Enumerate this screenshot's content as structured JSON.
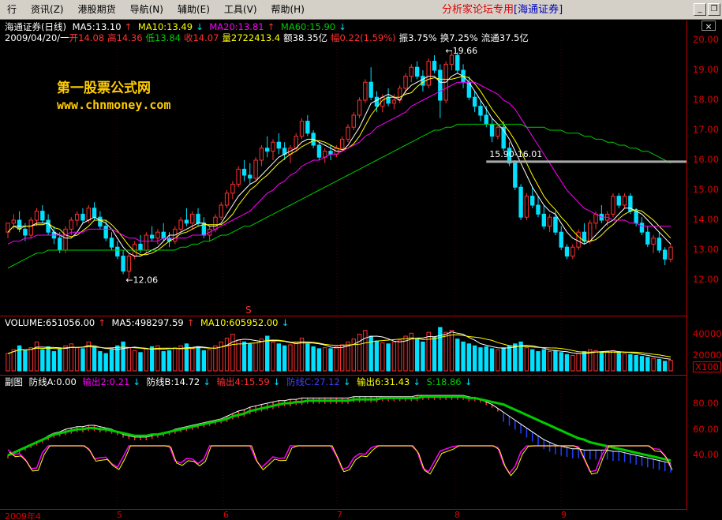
{
  "menu": {
    "items": [
      "行",
      "资讯(Z)",
      "港股期货",
      "导航(N)",
      "辅助(E)",
      "工具(V)",
      "帮助(H)"
    ],
    "title": "分析家论坛专用",
    "broker": "[海通证券]",
    "close": "×"
  },
  "main": {
    "stock": "海通证券(日线)",
    "ma5": "MA5:13.10",
    "ma10": "MA10:13.49",
    "ma20": "MA20:13.81",
    "ma60": "MA60:15.90",
    "info": {
      "date": "2009/04/20/一",
      "open": "开14.08",
      "high": "高14.36",
      "low": "低13.84",
      "close": "收14.07",
      "vol": "量2722413.4",
      "amount": "额38.35亿",
      "change": "幅0.22(1.59%)",
      "amplitude": "振3.75%",
      "turnover": "换7.25%",
      "float": "流通37.5亿"
    },
    "hi_label": "19.66",
    "lo_label": "12.06",
    "range_label": "15.90-16.01",
    "s_marker": "S",
    "watermark1": "第一股票公式网",
    "watermark2": "www.chnmoney.com",
    "y_labels": [
      "20.00",
      "19.00",
      "18.00",
      "17.00",
      "16.00",
      "15.00",
      "14.00",
      "13.00",
      "12.00"
    ]
  },
  "volume": {
    "label": "VOLUME:651056.00",
    "ma5": "MA5:498297.59",
    "ma10": "MA10:605952.00",
    "y_labels": [
      "40000",
      "20000",
      "X100"
    ]
  },
  "sub": {
    "title": "副图",
    "a": "防线A:0.00",
    "o2": "输出2:0.21",
    "b": "防线B:14.72",
    "o4": "输出4:15.59",
    "c": "防线C:27.12",
    "o6": "输出6:31.43",
    "s": "S:18.86",
    "y_labels": [
      "80.00",
      "60.00",
      "40.00"
    ]
  },
  "xaxis": [
    "2009年4",
    "5",
    "6",
    "7",
    "8",
    "9"
  ],
  "colors": {
    "up": "#ff3030",
    "down": "#00e0ff",
    "ma5": "#ffffff",
    "ma10": "#ffff00",
    "ma20": "#ff00ff",
    "ma60": "#00cc00",
    "grid": "#c00000"
  },
  "chart_data": {
    "type": "candlestick",
    "title": "海通证券(日线)",
    "price_axis": [
      12,
      20
    ],
    "candles": [
      [
        13.6,
        13.9,
        13.4,
        13.9
      ],
      [
        13.9,
        14.2,
        13.7,
        14.0
      ],
      [
        14.0,
        14.3,
        13.6,
        13.7
      ],
      [
        13.7,
        13.9,
        13.3,
        13.5
      ],
      [
        13.5,
        14.1,
        13.4,
        14.0
      ],
      [
        14.0,
        14.4,
        13.8,
        14.3
      ],
      [
        14.3,
        14.5,
        13.9,
        14.0
      ],
      [
        14.0,
        14.2,
        13.5,
        13.6
      ],
      [
        13.6,
        13.8,
        13.2,
        13.4
      ],
      [
        13.4,
        13.6,
        12.9,
        13.0
      ],
      [
        13.0,
        13.8,
        12.9,
        13.7
      ],
      [
        13.7,
        14.1,
        13.5,
        14.0
      ],
      [
        14.0,
        14.3,
        13.8,
        14.2
      ],
      [
        14.2,
        14.4,
        13.9,
        14.0
      ],
      [
        14.0,
        14.5,
        13.9,
        14.4
      ],
      [
        14.4,
        14.6,
        14.0,
        14.1
      ],
      [
        14.1,
        14.3,
        13.7,
        13.8
      ],
      [
        13.8,
        14.0,
        13.3,
        13.4
      ],
      [
        13.4,
        13.6,
        13.0,
        13.1
      ],
      [
        13.1,
        13.3,
        12.7,
        12.8
      ],
      [
        12.8,
        13.0,
        12.2,
        12.3
      ],
      [
        12.3,
        12.9,
        12.06,
        12.8
      ],
      [
        12.8,
        13.3,
        12.7,
        13.2
      ],
      [
        13.2,
        13.5,
        12.9,
        13.0
      ],
      [
        13.0,
        13.6,
        12.9,
        13.5
      ],
      [
        13.5,
        13.8,
        13.3,
        13.4
      ],
      [
        13.4,
        13.7,
        13.2,
        13.6
      ],
      [
        13.6,
        13.9,
        13.3,
        13.4
      ],
      [
        13.4,
        13.6,
        13.1,
        13.3
      ],
      [
        13.3,
        13.8,
        13.2,
        13.7
      ],
      [
        13.7,
        14.1,
        13.6,
        14.0
      ],
      [
        14.0,
        14.4,
        13.8,
        13.9
      ],
      [
        13.9,
        14.3,
        13.7,
        14.2
      ],
      [
        14.2,
        14.4,
        13.8,
        13.9
      ],
      [
        13.9,
        14.1,
        13.4,
        13.5
      ],
      [
        13.5,
        13.8,
        13.3,
        13.7
      ],
      [
        13.7,
        14.2,
        13.6,
        14.1
      ],
      [
        14.1,
        14.6,
        14.0,
        14.5
      ],
      [
        14.5,
        15.0,
        14.4,
        14.9
      ],
      [
        14.9,
        15.3,
        14.7,
        15.2
      ],
      [
        15.2,
        15.8,
        15.1,
        15.7
      ],
      [
        15.7,
        16.0,
        15.3,
        15.5
      ],
      [
        15.5,
        15.9,
        15.2,
        15.4
      ],
      [
        15.4,
        16.1,
        15.3,
        16.0
      ],
      [
        16.0,
        16.5,
        15.8,
        16.4
      ],
      [
        16.4,
        16.8,
        16.1,
        16.3
      ],
      [
        16.3,
        16.7,
        16.0,
        16.6
      ],
      [
        16.6,
        16.9,
        16.2,
        16.4
      ],
      [
        16.4,
        16.6,
        16.0,
        16.2
      ],
      [
        16.2,
        16.5,
        15.9,
        16.4
      ],
      [
        16.4,
        16.9,
        16.3,
        16.8
      ],
      [
        16.8,
        17.4,
        16.7,
        17.3
      ],
      [
        17.3,
        17.5,
        16.8,
        16.9
      ],
      [
        16.9,
        17.0,
        16.4,
        16.5
      ],
      [
        16.5,
        16.6,
        16.0,
        16.1
      ],
      [
        16.1,
        16.4,
        15.9,
        16.3
      ],
      [
        16.3,
        16.5,
        16.0,
        16.2
      ],
      [
        16.2,
        16.5,
        16.1,
        16.4
      ],
      [
        16.4,
        16.8,
        16.3,
        16.7
      ],
      [
        16.7,
        17.2,
        16.6,
        17.1
      ],
      [
        17.1,
        17.6,
        17.0,
        17.5
      ],
      [
        17.5,
        18.1,
        17.4,
        18.0
      ],
      [
        18.0,
        18.7,
        17.9,
        18.6
      ],
      [
        18.6,
        19.1,
        18.0,
        18.1
      ],
      [
        18.1,
        18.3,
        17.6,
        17.8
      ],
      [
        17.8,
        18.2,
        17.6,
        18.1
      ],
      [
        18.1,
        18.4,
        17.8,
        17.9
      ],
      [
        17.9,
        18.2,
        17.7,
        18.0
      ],
      [
        18.0,
        18.5,
        17.9,
        18.4
      ],
      [
        18.4,
        18.9,
        18.2,
        18.8
      ],
      [
        18.8,
        19.2,
        18.6,
        19.1
      ],
      [
        19.1,
        19.3,
        18.7,
        18.8
      ],
      [
        18.8,
        19.0,
        18.3,
        18.5
      ],
      [
        18.5,
        19.4,
        18.4,
        19.3
      ],
      [
        19.3,
        19.5,
        18.9,
        19.0
      ],
      [
        19.0,
        19.2,
        17.4,
        18.0
      ],
      [
        18.0,
        19.3,
        17.9,
        19.2
      ],
      [
        19.2,
        19.66,
        19.0,
        19.5
      ],
      [
        19.5,
        19.6,
        18.9,
        19.0
      ],
      [
        19.0,
        19.2,
        18.4,
        18.6
      ],
      [
        18.6,
        18.8,
        18.0,
        18.1
      ],
      [
        18.1,
        18.3,
        17.6,
        17.8
      ],
      [
        17.8,
        18.0,
        17.3,
        17.5
      ],
      [
        17.5,
        17.8,
        17.1,
        17.2
      ],
      [
        17.2,
        17.4,
        16.6,
        16.8
      ],
      [
        16.8,
        17.2,
        16.7,
        17.1
      ],
      [
        17.1,
        17.3,
        16.3,
        16.4
      ],
      [
        16.4,
        16.6,
        15.8,
        15.9
      ],
      [
        15.9,
        16.0,
        15.0,
        15.1
      ],
      [
        15.1,
        15.2,
        14.0,
        14.1
      ],
      [
        14.1,
        14.9,
        14.0,
        14.8
      ],
      [
        14.8,
        15.1,
        14.4,
        14.5
      ],
      [
        14.5,
        14.8,
        14.1,
        14.2
      ],
      [
        14.2,
        14.5,
        13.7,
        13.8
      ],
      [
        13.8,
        14.2,
        13.6,
        14.1
      ],
      [
        14.1,
        14.3,
        13.5,
        13.6
      ],
      [
        13.6,
        13.8,
        13.0,
        13.1
      ],
      [
        13.1,
        13.2,
        12.7,
        12.8
      ],
      [
        12.8,
        13.2,
        12.7,
        13.1
      ],
      [
        13.1,
        13.7,
        13.0,
        13.6
      ],
      [
        13.6,
        13.9,
        13.2,
        13.3
      ],
      [
        13.3,
        14.0,
        13.2,
        13.9
      ],
      [
        13.9,
        14.3,
        13.7,
        14.2
      ],
      [
        14.2,
        14.5,
        13.9,
        14.0
      ],
      [
        14.0,
        14.3,
        13.8,
        14.2
      ],
      [
        14.2,
        14.9,
        14.1,
        14.8
      ],
      [
        14.8,
        14.9,
        14.4,
        14.5
      ],
      [
        14.5,
        14.9,
        14.4,
        14.8
      ],
      [
        14.8,
        14.9,
        14.2,
        14.3
      ],
      [
        14.3,
        14.4,
        13.8,
        13.9
      ],
      [
        13.9,
        14.1,
        13.5,
        13.6
      ],
      [
        13.6,
        13.8,
        13.1,
        13.2
      ],
      [
        13.2,
        13.5,
        12.9,
        13.4
      ],
      [
        13.4,
        13.6,
        12.9,
        13.0
      ],
      [
        13.0,
        13.1,
        12.5,
        12.7
      ],
      [
        12.7,
        13.2,
        12.6,
        13.1
      ]
    ],
    "ma_lines": {
      "MA5": [
        13.6,
        13.8,
        13.8,
        13.8,
        13.8,
        13.9,
        13.9,
        13.9,
        13.6,
        13.5,
        13.4,
        13.4,
        13.6,
        13.9,
        14.0,
        14.1,
        14.0,
        13.9,
        13.7,
        13.4,
        13.1,
        12.9,
        12.8,
        12.8,
        12.9,
        13.0,
        13.1,
        13.3,
        13.5,
        13.5,
        13.6,
        13.7,
        13.8,
        13.9,
        13.9,
        13.8,
        13.8,
        13.9,
        14.2,
        14.5,
        14.8,
        15.0,
        15.2,
        15.3,
        15.5,
        15.7,
        15.9,
        16.1,
        16.2,
        16.3,
        16.4,
        16.6,
        16.7,
        16.7,
        16.6,
        16.5,
        16.4,
        16.3,
        16.3,
        16.5,
        16.8,
        17.1,
        17.5,
        17.9,
        18.0,
        18.1,
        18.2,
        18.1,
        18.0,
        18.3,
        18.5,
        18.6,
        18.7,
        18.8,
        18.8,
        18.6,
        18.6,
        18.8,
        18.9,
        18.8,
        18.6,
        18.3,
        18.0,
        17.7,
        17.4,
        17.2,
        17.0,
        16.7,
        16.3,
        15.9,
        15.5,
        15.1,
        14.8,
        14.5,
        14.3,
        14.2,
        13.9,
        13.6,
        13.4,
        13.3,
        13.2,
        13.3,
        13.5,
        13.7,
        13.9,
        14.0,
        14.2,
        14.4,
        14.4,
        14.3,
        14.2,
        14.0,
        13.8,
        13.6,
        13.4,
        13.2
      ],
      "MA20": [
        13.2,
        13.3,
        13.3,
        13.4,
        13.4,
        13.5,
        13.5,
        13.5,
        13.5,
        13.5,
        13.5,
        13.6,
        13.6,
        13.6,
        13.7,
        13.7,
        13.7,
        13.7,
        13.7,
        13.6,
        13.5,
        13.4,
        13.4,
        13.3,
        13.3,
        13.3,
        13.3,
        13.4,
        13.4,
        13.4,
        13.4,
        13.4,
        13.5,
        13.5,
        13.5,
        13.6,
        13.7,
        13.8,
        13.9,
        14.0,
        14.1,
        14.2,
        14.3,
        14.5,
        14.7,
        14.9,
        15.0,
        15.2,
        15.3,
        15.5,
        15.6,
        15.8,
        15.9,
        16.0,
        16.0,
        16.1,
        16.2,
        16.2,
        16.3,
        16.4,
        16.5,
        16.6,
        16.8,
        16.9,
        17.1,
        17.2,
        17.3,
        17.4,
        17.5,
        17.6,
        17.8,
        17.9,
        18.0,
        18.1,
        18.2,
        18.3,
        18.4,
        18.5,
        18.6,
        18.6,
        18.6,
        18.6,
        18.5,
        18.4,
        18.3,
        18.2,
        18.0,
        17.9,
        17.7,
        17.4,
        17.1,
        16.8,
        16.5,
        16.2,
        15.9,
        15.6,
        15.3,
        15.0,
        14.8,
        14.6,
        14.4,
        14.3,
        14.2,
        14.1,
        14.1,
        14.0,
        14.0,
        14.0,
        13.9,
        13.9,
        13.8,
        13.8,
        13.8,
        13.8,
        13.8,
        13.8
      ],
      "MA60": [
        12.4,
        12.5,
        12.6,
        12.7,
        12.8,
        12.9,
        12.9,
        13.0,
        13.0,
        13.0,
        13.0,
        13.0,
        13.0,
        13.0,
        13.0,
        13.0,
        13.0,
        13.0,
        13.0,
        13.0,
        13.0,
        13.0,
        13.0,
        13.0,
        13.0,
        13.0,
        13.0,
        13.0,
        13.0,
        13.0,
        13.1,
        13.1,
        13.2,
        13.2,
        13.3,
        13.3,
        13.4,
        13.5,
        13.5,
        13.6,
        13.7,
        13.8,
        13.8,
        13.9,
        14.0,
        14.1,
        14.2,
        14.3,
        14.4,
        14.5,
        14.6,
        14.7,
        14.8,
        14.9,
        15.0,
        15.1,
        15.2,
        15.3,
        15.4,
        15.5,
        15.6,
        15.7,
        15.8,
        15.9,
        16.0,
        16.1,
        16.2,
        16.3,
        16.4,
        16.5,
        16.6,
        16.7,
        16.8,
        16.9,
        17.0,
        17.0,
        17.1,
        17.1,
        17.2,
        17.2,
        17.2,
        17.2,
        17.2,
        17.2,
        17.2,
        17.2,
        17.2,
        17.2,
        17.2,
        17.2,
        17.1,
        17.1,
        17.1,
        17.1,
        17.0,
        17.0,
        17.0,
        16.9,
        16.9,
        16.9,
        16.8,
        16.8,
        16.7,
        16.7,
        16.6,
        16.6,
        16.5,
        16.5,
        16.4,
        16.4,
        16.3,
        16.3,
        16.2,
        16.1,
        16.0,
        15.9
      ]
    },
    "volume": [
      180,
      220,
      260,
      210,
      240,
      300,
      220,
      250,
      200,
      230,
      260,
      280,
      240,
      230,
      300,
      250,
      200,
      180,
      220,
      260,
      300,
      240,
      210,
      190,
      230,
      250,
      260,
      200,
      210,
      240,
      260,
      280,
      230,
      250,
      210,
      220,
      260,
      300,
      340,
      380,
      320,
      300,
      280,
      290,
      330,
      360,
      300,
      280,
      260,
      270,
      300,
      340,
      280,
      250,
      230,
      240,
      230,
      250,
      270,
      300,
      330,
      380,
      420,
      360,
      310,
      290,
      280,
      300,
      320,
      360,
      390,
      330,
      300,
      400,
      350,
      450,
      400,
      420,
      330,
      300,
      280,
      260,
      240,
      250,
      230,
      220,
      240,
      260,
      280,
      300,
      240,
      220,
      200,
      220,
      200,
      210,
      190,
      170,
      160,
      180,
      200,
      220,
      210,
      190,
      200,
      210,
      190,
      180,
      170,
      160,
      150,
      140,
      130,
      120,
      100,
      110
    ],
    "vol_axis": [
      0,
      45000
    ],
    "sub_lines": {
      "输出4": [
        40,
        42,
        44,
        46,
        48,
        50,
        52,
        55,
        57,
        58,
        60,
        61,
        62,
        62,
        63,
        63,
        62,
        61,
        60,
        58,
        56,
        55,
        54,
        54,
        54,
        55,
        56,
        57,
        58,
        60,
        61,
        62,
        63,
        64,
        65,
        66,
        67,
        68,
        70,
        72,
        74,
        75,
        77,
        78,
        79,
        80,
        81,
        82,
        82,
        83,
        83,
        84,
        84,
        84,
        84,
        84,
        84,
        84,
        84,
        84,
        85,
        85,
        85,
        85,
        85,
        85,
        85,
        85,
        85,
        85,
        85,
        86,
        86,
        86,
        86,
        86,
        86,
        86,
        86,
        86,
        85,
        84,
        83,
        81,
        79,
        76,
        73,
        70,
        67,
        64,
        61,
        58,
        55,
        52,
        50,
        48,
        47,
        46,
        45,
        45,
        44,
        44,
        44,
        44,
        44,
        43,
        43,
        42,
        41,
        40,
        39,
        38,
        37,
        36,
        35,
        34
      ],
      "S": [
        40,
        42,
        44,
        46,
        48,
        50,
        52,
        54,
        56,
        57,
        58,
        59,
        60,
        60,
        61,
        61,
        60,
        60,
        59,
        58,
        57,
        56,
        55,
        55,
        55,
        56,
        56,
        57,
        58,
        59,
        60,
        61,
        62,
        63,
        64,
        65,
        66,
        67,
        68,
        70,
        71,
        72,
        74,
        75,
        76,
        77,
        78,
        79,
        80,
        80,
        81,
        81,
        82,
        82,
        82,
        82,
        82,
        82,
        82,
        82,
        83,
        83,
        83,
        83,
        83,
        84,
        84,
        84,
        84,
        84,
        84,
        84,
        85,
        85,
        85,
        85,
        85,
        85,
        85,
        85,
        84,
        84,
        83,
        82,
        81,
        80,
        79,
        77,
        75,
        73,
        71,
        69,
        67,
        65,
        63,
        61,
        59,
        57,
        55,
        53,
        52,
        50,
        49,
        48,
        47,
        46,
        45,
        44,
        43,
        42,
        41,
        40,
        39,
        38,
        37,
        36
      ]
    },
    "x_ticks": [
      "2009年4",
      "5",
      "6",
      "7",
      "8",
      "9"
    ]
  }
}
